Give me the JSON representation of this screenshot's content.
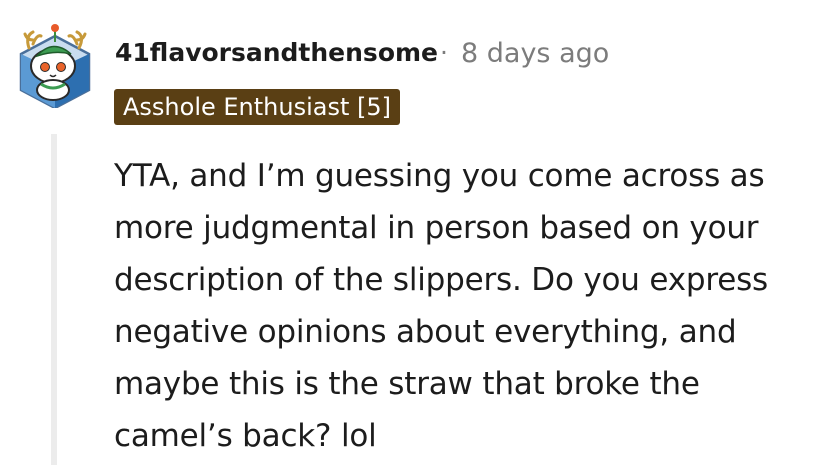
{
  "comment": {
    "username": "41flavorsandthensome",
    "separator": "·",
    "timestamp": "8 days ago",
    "flair": "Asshole Enthusiast [5]",
    "avatar_icon": "snoo-avatar-icon",
    "body": "YTA, and I’m guessing you come across as more judgmental in person based on your description of the slippers. Do you express negative opinions about everything, and maybe this is the straw that broke the camel’s back? lol"
  },
  "colors": {
    "flair_background": "#5a3f14",
    "meta_text": "#7c7c7c",
    "thread_line": "#ececec"
  }
}
